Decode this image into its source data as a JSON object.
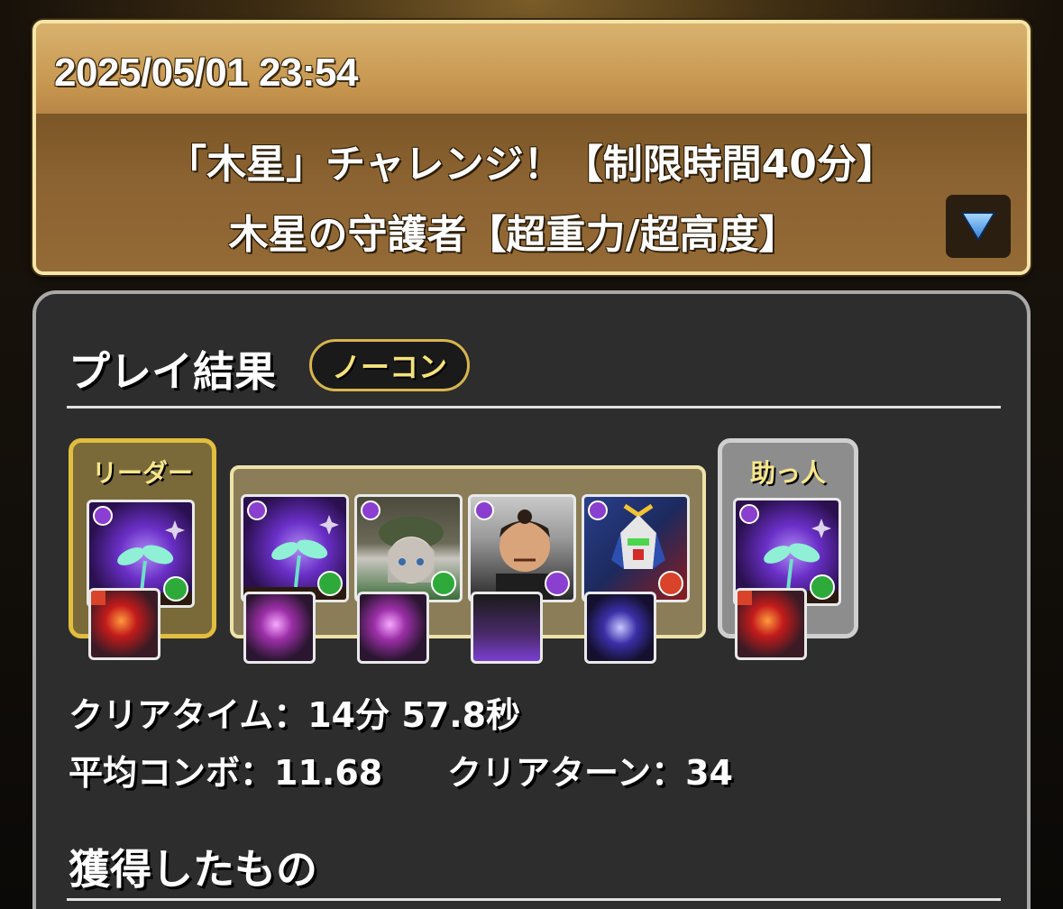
{
  "header": {
    "date": "2025/05/01 23:54",
    "dungeon_title": "「木星」チャレンジ！【制限時間40分】",
    "floor_title": "木星の守護者【超重力/超高度】",
    "expand_icon": "triangle-down-icon"
  },
  "result": {
    "title": "プレイ結果",
    "badge": "ノーコン",
    "leader_label": "リーダー",
    "helper_label": "助っ人",
    "clear_time": "クリアタイム：14分 57.8秒",
    "avg_combo": "平均コンボ：11.68",
    "clear_turns": "クリアターン：34"
  },
  "rewards": {
    "title": "獲得したもの"
  },
  "colors": {
    "header_gold": "#c6964f",
    "panel_bg": "#2d2d2d",
    "leader_border": "#e1be3e",
    "badge_text": "#f5e27b",
    "dark_attr": "#8a3fd1",
    "wood_attr": "#2eaa3a",
    "fire_attr": "#d9432a"
  }
}
